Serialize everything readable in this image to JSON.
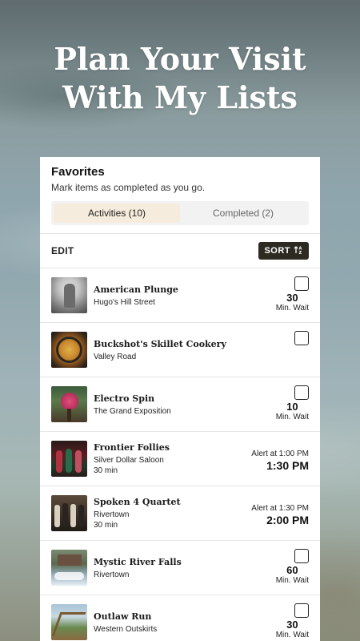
{
  "hero": {
    "line1": "Plan Your Visit",
    "line2": "With My Lists"
  },
  "card": {
    "title": "Favorites",
    "subtitle": "Mark items as completed as you go.",
    "tabs": [
      {
        "label": "Activities (10)",
        "active": true
      },
      {
        "label": "Completed (2)",
        "active": false
      }
    ],
    "edit_label": "EDIT",
    "sort_label": "SORT",
    "sort_icon": "sort-icon"
  },
  "items": [
    {
      "name": "American Plunge",
      "location": "Hugo's Hill Street",
      "duration": "",
      "wait": "30",
      "wait_label": "Min. Wait",
      "checkbox": true
    },
    {
      "name": "Buckshot's Skillet Cookery",
      "location": "Valley Road",
      "duration": "",
      "wait": "",
      "wait_label": "",
      "checkbox": true
    },
    {
      "name": "Electro Spin",
      "location": "The Grand Exposition",
      "duration": "",
      "wait": "10",
      "wait_label": "Min. Wait",
      "checkbox": true
    },
    {
      "name": "Frontier Follies",
      "location": "Silver Dollar Saloon",
      "duration": "30 min",
      "alert": "Alert at 1:00 PM",
      "time": "1:30 PM"
    },
    {
      "name": "Spoken 4 Quartet",
      "location": "Rivertown",
      "duration": "30 min",
      "alert": "Alert at 1:30 PM",
      "time": "2:00 PM"
    },
    {
      "name": "Mystic River Falls",
      "location": "Rivertown",
      "duration": "",
      "wait": "60",
      "wait_label": "Min. Wait",
      "checkbox": true
    },
    {
      "name": "Outlaw Run",
      "location": "Western Outskirts",
      "duration": "",
      "wait": "30",
      "wait_label": "Min. Wait",
      "checkbox": true
    }
  ],
  "colors": {
    "sort_bg": "#2d2a22",
    "active_tab": "#f6ecdd"
  }
}
